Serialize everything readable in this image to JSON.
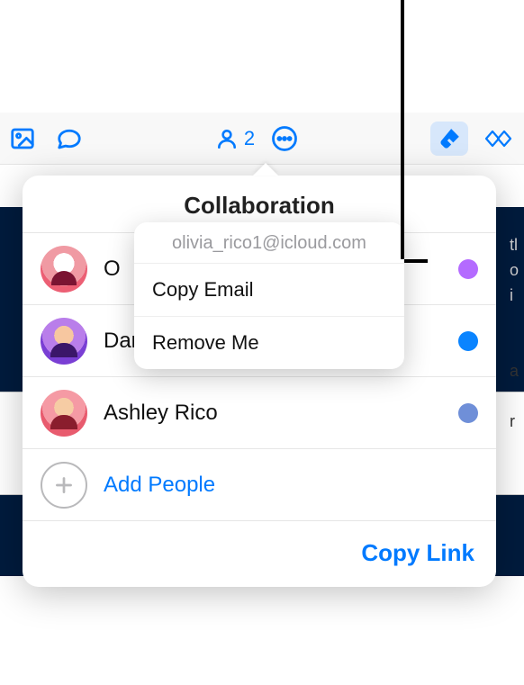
{
  "toolbar": {
    "collab_count": "2"
  },
  "popover": {
    "title": "Collaboration",
    "people": [
      {
        "name": "Olivia Rico",
        "name_visible": "O",
        "dot_color": "#b46bff"
      },
      {
        "name": "Danny Rico (Owner)",
        "dot_color": "#0a84ff"
      },
      {
        "name": "Ashley Rico",
        "dot_color": "#6f8fd8"
      }
    ],
    "add_label": "Add People",
    "copy_link_label": "Copy Link"
  },
  "context_menu": {
    "email": "olivia_rico1@icloud.com",
    "items": [
      "Copy Email",
      "Remove Me"
    ]
  },
  "background_text": {
    "l1": "tl",
    "l2": "o",
    "l3": "i",
    "l4": "a",
    "l5": "r"
  }
}
